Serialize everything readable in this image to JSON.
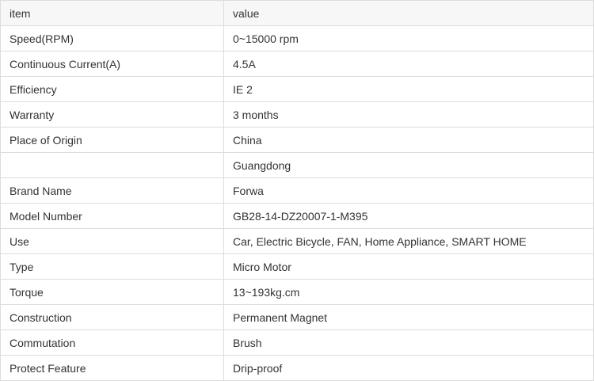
{
  "table": {
    "headers": [
      "item",
      "value"
    ],
    "rows": [
      [
        "Speed(RPM)",
        "0~15000 rpm"
      ],
      [
        "Continuous Current(A)",
        "4.5A"
      ],
      [
        "Efficiency",
        "IE 2"
      ],
      [
        "Warranty",
        "3 months"
      ],
      [
        "Place of Origin",
        "China"
      ],
      [
        "",
        "Guangdong"
      ],
      [
        "Brand Name",
        "Forwa"
      ],
      [
        "Model Number",
        "GB28-14-DZ20007-1-M395"
      ],
      [
        "Use",
        "Car, Electric Bicycle, FAN, Home Appliance, SMART HOME"
      ],
      [
        "Type",
        "Micro Motor"
      ],
      [
        "Torque",
        "13~193kg.cm"
      ],
      [
        "Construction",
        "Permanent Magnet"
      ],
      [
        "Commutation",
        "Brush"
      ],
      [
        "Protect Feature",
        "Drip-proof"
      ]
    ]
  },
  "colors": {
    "border": "#dcdcdc",
    "header_background": "#f7f7f7",
    "text": "#333333"
  }
}
